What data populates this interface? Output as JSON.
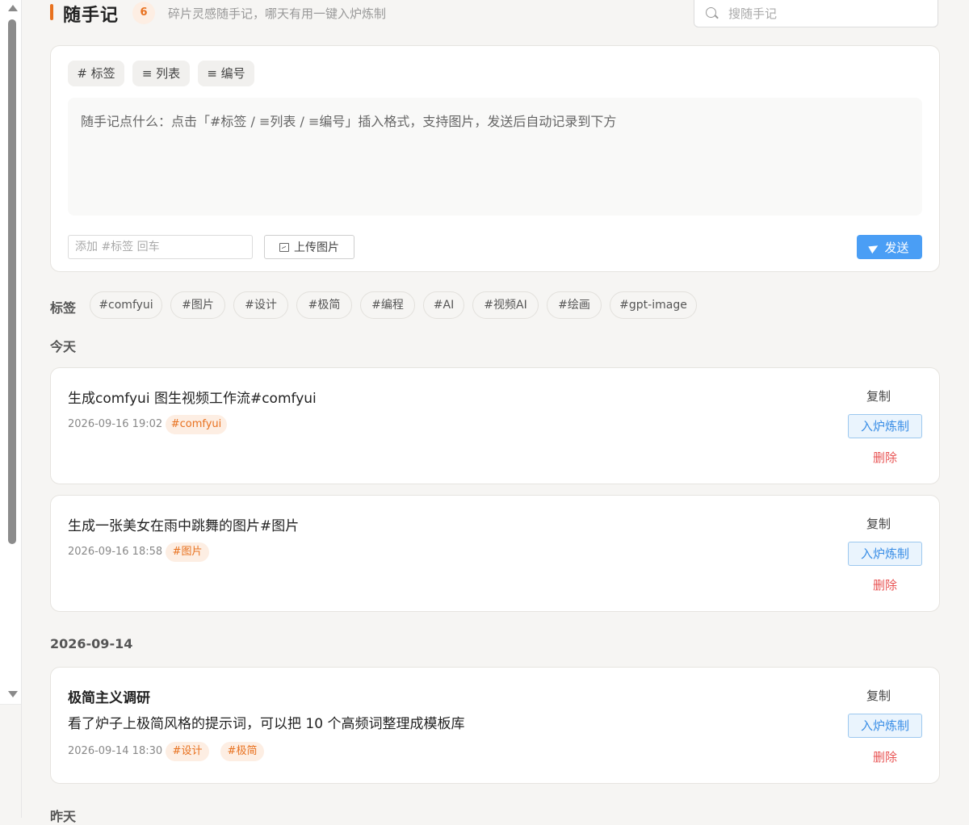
{
  "header": {
    "title": "随手记",
    "count": "6",
    "subtitle": "碎片灵感随手记，哪天有用一键入炉炼制",
    "search_placeholder": "搜随手记"
  },
  "composer": {
    "format_buttons": [
      "# 标签",
      "≡ 列表",
      "≡ 编号"
    ],
    "editor_placeholder": "随手记点什么：点击「#标签 / ≡列表 / ≡编号」插入格式，支持图片，发送后自动记录到下方",
    "tag_input_placeholder": "添加 #标签 回车",
    "upload_label": "上传图片",
    "send_label": "发送"
  },
  "tags": {
    "label": "标签",
    "items": [
      "#comfyui",
      "#图片",
      "#设计",
      "#极简",
      "#编程",
      "#AI",
      "#视频AI",
      "#绘画",
      "#gpt-image"
    ]
  },
  "actions": {
    "copy": "复制",
    "refine": "入炉炼制",
    "delete": "删除"
  },
  "sections": [
    {
      "label": "今天",
      "notes": [
        {
          "title": "",
          "text": "生成comfyui 图生视频工作流#comfyui",
          "date": "2026-09-16 19:02",
          "tags": [
            "#comfyui"
          ]
        },
        {
          "title": "",
          "text": "生成一张美女在雨中跳舞的图片#图片",
          "date": "2026-09-16 18:58",
          "tags": [
            "#图片"
          ]
        }
      ]
    },
    {
      "label": "2026-09-14",
      "notes": [
        {
          "title": "极简主义调研",
          "text": "看了炉子上极简风格的提示词，可以把 10 个高频词整理成模板库",
          "date": "2026-09-14 18:30",
          "tags": [
            "#设计",
            "#极简"
          ]
        }
      ]
    },
    {
      "label": "昨天",
      "notes": []
    }
  ]
}
